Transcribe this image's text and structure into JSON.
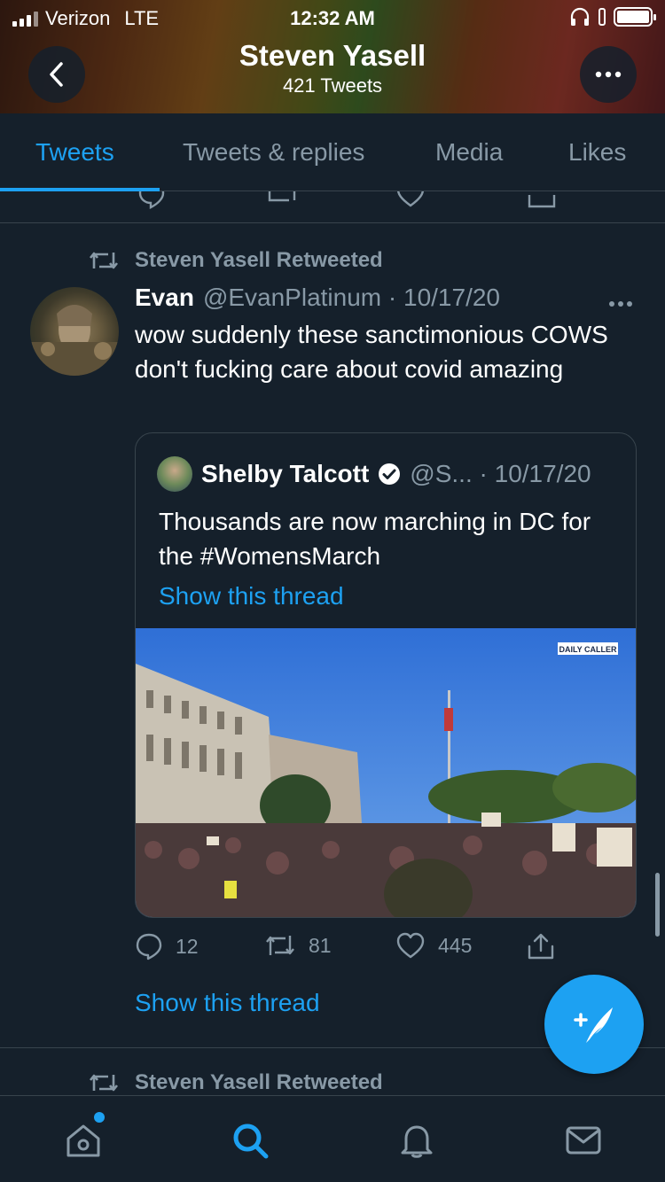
{
  "status_bar": {
    "carrier": "Verizon",
    "network": "LTE",
    "time": "12:32 AM"
  },
  "profile": {
    "name": "Steven Yasell",
    "tweet_count": "421 Tweets"
  },
  "tabs": [
    {
      "label": "Tweets",
      "active": true
    },
    {
      "label": "Tweets & replies",
      "active": false
    },
    {
      "label": "Media",
      "active": false
    },
    {
      "label": "Likes",
      "active": false
    }
  ],
  "tweet": {
    "retweet_label": "Steven Yasell Retweeted",
    "author_name": "Evan",
    "handle_date": "@EvanPlatinum · 10/17/20",
    "text": "wow suddenly these sanctimonious COWS don't fucking care about covid amazing",
    "quote": {
      "author_name": "Shelby Talcott",
      "handle_date": "@S... · 10/17/20",
      "text": "Thousands are now marching in DC for the #WomensMarch",
      "show_thread": "Show this thread",
      "media_watermark": "DAILY CALLER"
    },
    "actions": {
      "replies": "12",
      "retweets": "81",
      "likes": "445"
    },
    "show_thread": "Show this thread"
  },
  "next_tweet": {
    "retweet_label": "Steven Yasell Retweeted"
  },
  "bottom_nav": [
    "home-icon",
    "search-icon",
    "notifications-icon",
    "messages-icon"
  ],
  "colors": {
    "background": "#15202b",
    "accent": "#1da1f2",
    "secondary_text": "#8899a6",
    "border": "#38444d"
  }
}
